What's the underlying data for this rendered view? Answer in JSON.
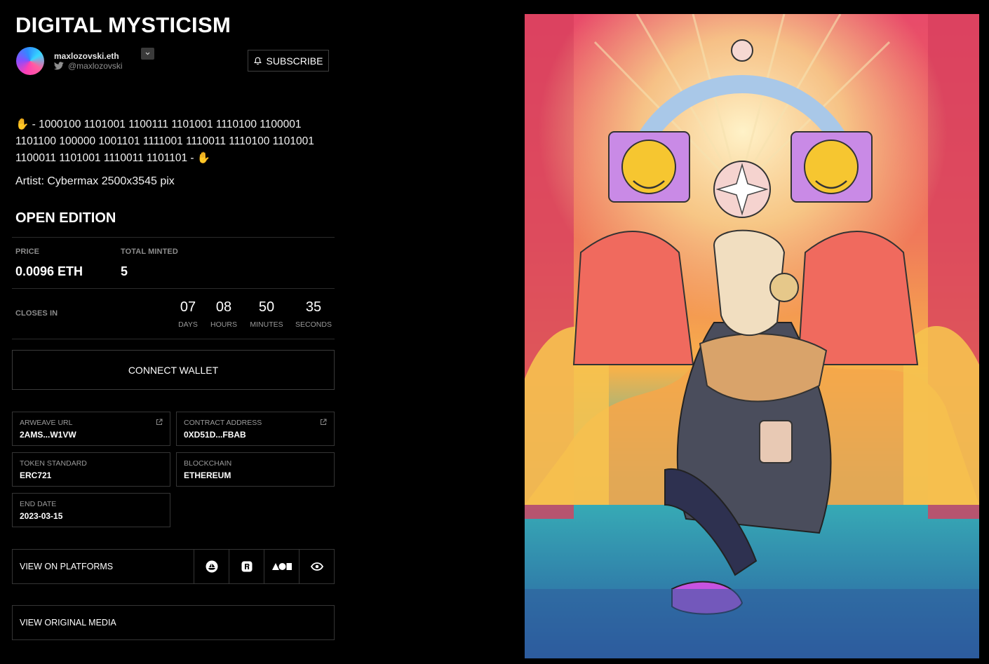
{
  "title": "DIGITAL MYSTICISM",
  "author": {
    "name": "maxlozovski.eth",
    "handle": "@maxlozovski"
  },
  "subscribe_label": "SUBSCRIBE",
  "description": "✋ - 1000100 1101001 1100111 1101001 1110100 1100001 1101100 100000 1001101 1111001 1110011 1110100 1101001 1100011 1101001 1110011 1101101 - ✋",
  "artist_line": "Artist: Cybermax 2500x3545 pix",
  "edition_type": "OPEN EDITION",
  "price": {
    "label": "PRICE",
    "value": "0.0096 ETH"
  },
  "minted": {
    "label": "TOTAL MINTED",
    "value": "5"
  },
  "countdown": {
    "label": "CLOSES IN",
    "days": "07",
    "days_label": "DAYS",
    "hours": "08",
    "hours_label": "HOURS",
    "minutes": "50",
    "minutes_label": "MINUTES",
    "seconds": "35",
    "seconds_label": "SECONDS"
  },
  "connect_label": "CONNECT WALLET",
  "details": {
    "arweave": {
      "label": "ARWEAVE URL",
      "value": "2AMS...W1VW"
    },
    "contract": {
      "label": "CONTRACT ADDRESS",
      "value": "0XD51D...FBAB"
    },
    "standard": {
      "label": "TOKEN STANDARD",
      "value": "ERC721"
    },
    "chain": {
      "label": "BLOCKCHAIN",
      "value": "ETHEREUM"
    },
    "end": {
      "label": "END DATE",
      "value": "2023-03-15"
    }
  },
  "platforms_label": "VIEW ON PLATFORMS",
  "original_media_label": "VIEW ORIGINAL MEDIA",
  "platform_icons": [
    "opensea-icon",
    "rarible-icon",
    "foundation-icon",
    "eye-icon"
  ],
  "colors": {
    "background": "#000000",
    "border": "#353535",
    "muted": "#8c8c8c"
  }
}
